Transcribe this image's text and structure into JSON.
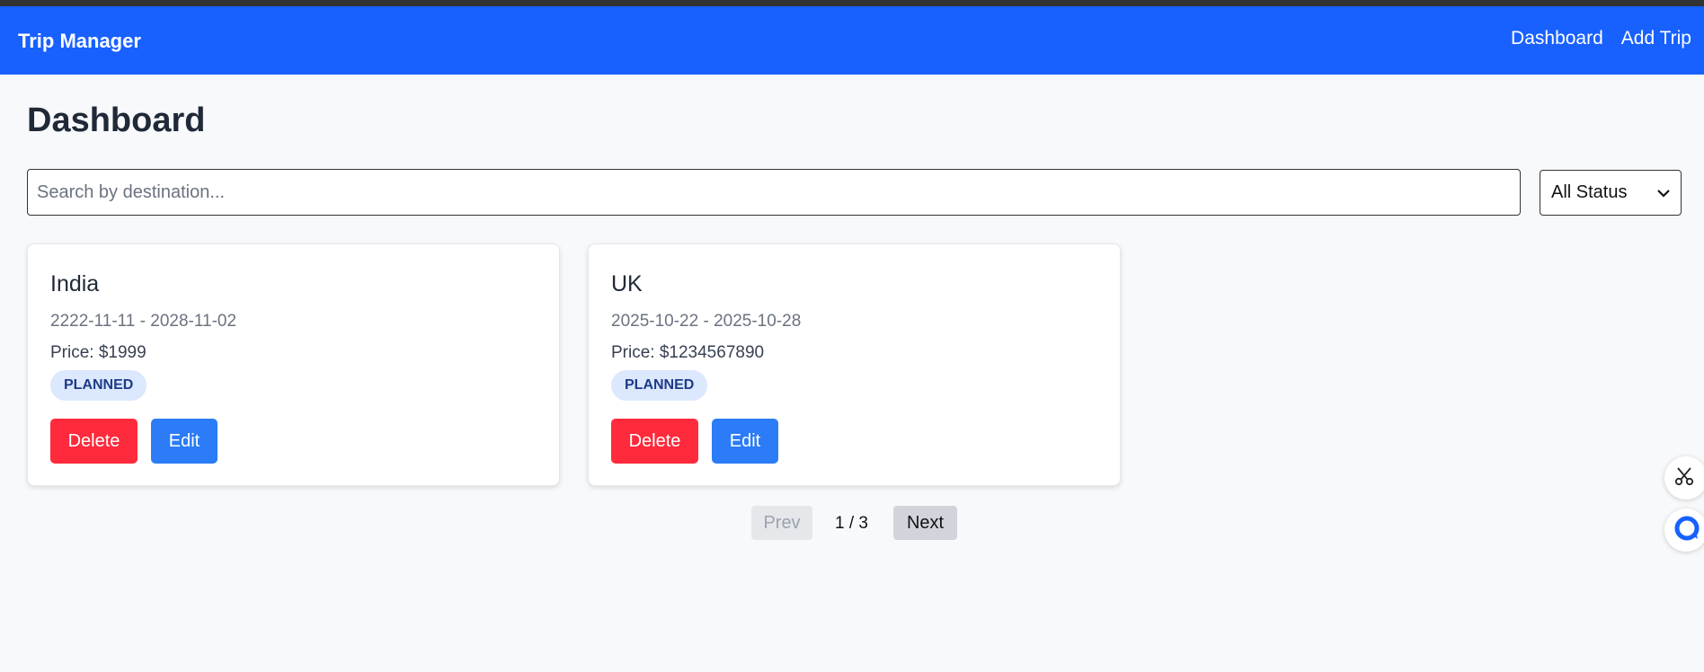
{
  "app": {
    "brand": "Trip Manager"
  },
  "nav": {
    "dashboard": "Dashboard",
    "add_trip": "Add Trip"
  },
  "page": {
    "title": "Dashboard"
  },
  "search": {
    "placeholder": "Search by destination...",
    "value": ""
  },
  "filter": {
    "selected": "All Status"
  },
  "trips": [
    {
      "destination": "India",
      "dates": "2222-11-11 - 2028-11-02",
      "price": "Price: $1999",
      "status": "PLANNED",
      "delete_label": "Delete",
      "edit_label": "Edit"
    },
    {
      "destination": "UK",
      "dates": "2025-10-22 - 2025-10-28",
      "price": "Price: $1234567890",
      "status": "PLANNED",
      "delete_label": "Delete",
      "edit_label": "Edit"
    }
  ],
  "pagination": {
    "prev_label": "Prev",
    "indicator": "1 / 3",
    "next_label": "Next"
  },
  "floating": {
    "tool_icon": "scissors-icon",
    "chat_icon": "chat-icon"
  },
  "colors": {
    "primary": "#1861ff",
    "danger": "#ff2a3b",
    "edit": "#2b7cf6",
    "badge_bg": "#dbe8fd",
    "badge_text": "#1e3a8a"
  }
}
